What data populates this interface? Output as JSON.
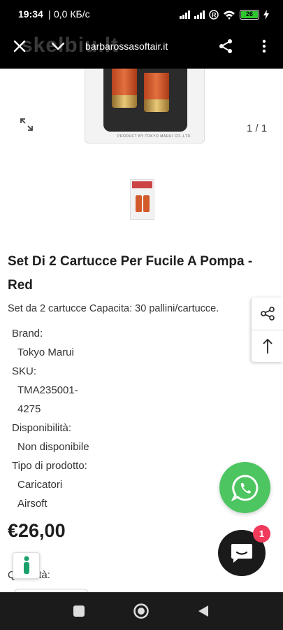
{
  "status_bar": {
    "time": "19:34",
    "separator": "|",
    "net_speed": "0,0 КБ/с",
    "battery": "26"
  },
  "browser": {
    "url": "barbarossasoftair.it",
    "watermark": "skelbiu.lt",
    "icons": [
      "close-icon",
      "chevron-down-icon",
      "share-icon",
      "more-vert-icon"
    ]
  },
  "gallery": {
    "counter": "1 / 1",
    "caption": "PRODUCT BY TOKYO MARUI CO.,LTD."
  },
  "product": {
    "title": "Set Di 2 Cartucce Per Fucile A Pompa - Red",
    "description": "Set da 2 cartucce Capacita: 30 pallini/cartucce.",
    "specs": {
      "brand_label": "Brand:",
      "brand_value": "Tokyo Marui",
      "sku_label": "SKU:",
      "sku_value_line1": "TMA235001-",
      "sku_value_line2": "4275",
      "availability_label": "Disponibilità:",
      "availability_value": "Non disponibile",
      "type_label": "Tipo di prodotto:",
      "type_value_line1": "Caricatori",
      "type_value_line2": "Airsoft"
    },
    "price": "€26,00",
    "quantity_label": "Quantità:"
  },
  "chat": {
    "badge": "1"
  },
  "colors": {
    "whatsapp": "#4dc560",
    "chat_badge": "#f23a5c",
    "accessibility_figure": "#1aa06a"
  }
}
